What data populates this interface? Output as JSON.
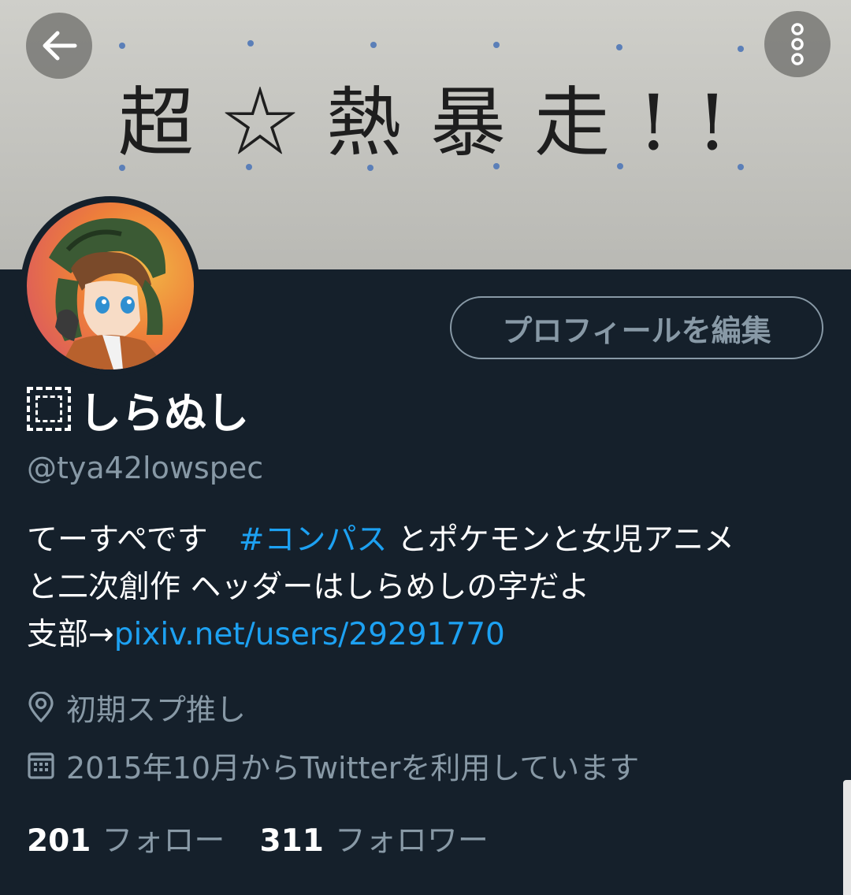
{
  "header": {
    "banner_text": "超☆熱暴走!!",
    "back_icon": "arrow-left-icon",
    "more_icon": "more-vertical-icon"
  },
  "profile": {
    "edit_button_label": "プロフィールを編集",
    "display_name": "しらぬし",
    "handle": "@tya42lowspec",
    "bio": {
      "line1_prefix": "てーすぺです　",
      "hashtag": "#コンパス",
      "line1_suffix": " とポケモンと女児アニメ",
      "line2": "と二次創作 ヘッダーはしらめしの字だよ",
      "line3_prefix": "支部→",
      "link": "pixiv.net/users/29291770"
    },
    "location": "初期スプ推し",
    "joined": "2015年10月からTwitterを利用しています"
  },
  "stats": {
    "following_count": "201",
    "following_label": "フォロー",
    "followers_count": "311",
    "followers_label": "フォロワー"
  },
  "colors": {
    "background": "#15202b",
    "secondary_text": "#8899a6",
    "link": "#1da1f2"
  }
}
